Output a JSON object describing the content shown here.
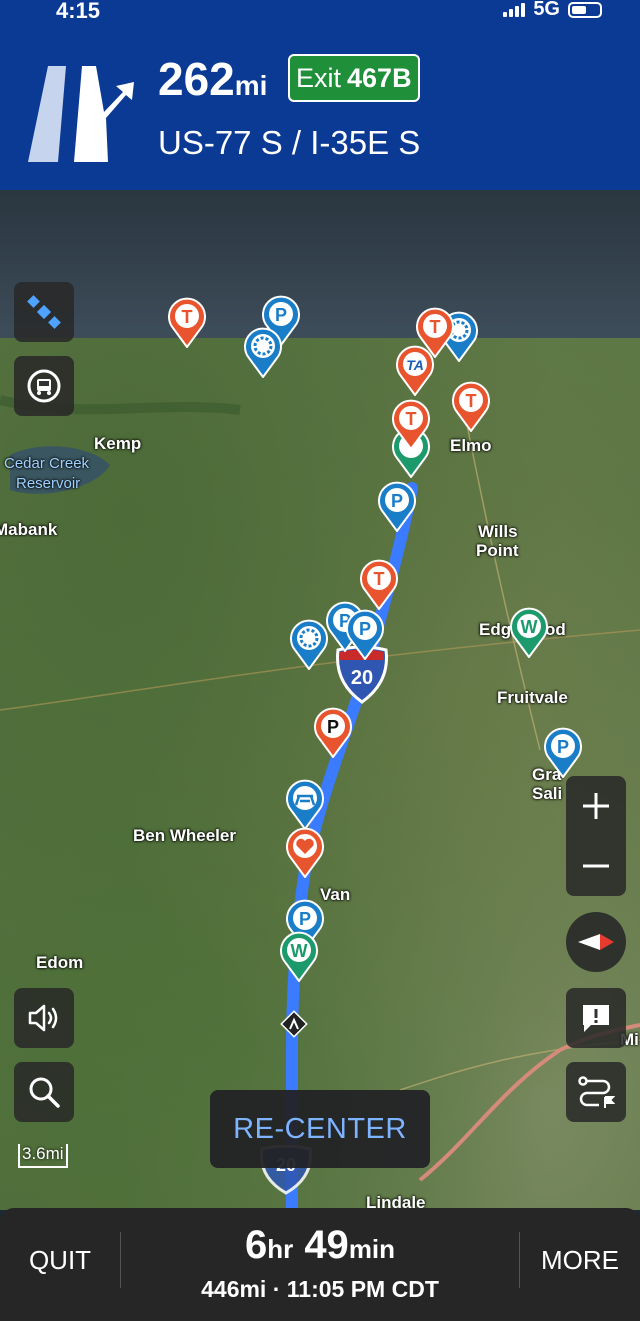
{
  "status": {
    "time": "4:15",
    "network": "5G"
  },
  "nav": {
    "distance_value": "262",
    "distance_unit": "mi",
    "exit_label": "Exit",
    "exit_number": "467B",
    "road": "US-77 S / I-35E S"
  },
  "map": {
    "places": [
      "Kemp",
      "Cedar Creek",
      "Reservoir",
      "Mabank",
      "Elmo",
      "Wills",
      "Point",
      "Edg",
      "od",
      "Fruitvale",
      "Gra",
      "Sali",
      "Ben Wheeler",
      "Van",
      "Edom",
      "Lindale",
      "Mi"
    ],
    "interstate_numbers": [
      "20",
      "20"
    ],
    "scale": "3.6mi",
    "pin_letters": {
      "truckstop": "T",
      "parking": "P",
      "walmart": "W",
      "ta": "TA",
      "paid_parking": "P"
    },
    "recenter_label": "RE-CENTER"
  },
  "trip": {
    "quit_label": "QUIT",
    "more_label": "MORE",
    "hours": "6",
    "hours_unit": "hr",
    "minutes": "49",
    "minutes_unit": "min",
    "summary": "446mi · 11:05 PM CDT"
  },
  "colors": {
    "banner": "#0b3a94",
    "exit_green": "#1f8f3a",
    "route_blue": "#3a7bff",
    "pin_orange": "#e8542e",
    "pin_blue": "#1a7dc7",
    "pin_green": "#1d9a6c",
    "recenter_text": "#7db3ff"
  }
}
